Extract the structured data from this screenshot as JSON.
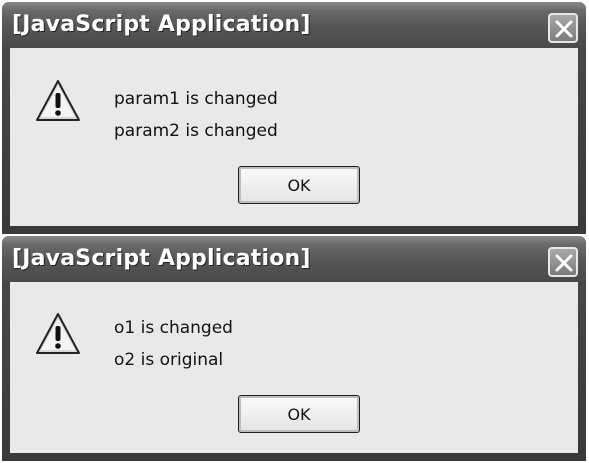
{
  "dialogs": [
    {
      "title": "[JavaScript Application]",
      "icon": "warning-icon",
      "lines": [
        "param1 is changed",
        "param2 is changed"
      ],
      "ok_label": "OK"
    },
    {
      "title": "[JavaScript Application]",
      "icon": "warning-icon",
      "lines": [
        "o1 is changed",
        "o2 is original"
      ],
      "ok_label": "OK"
    }
  ]
}
